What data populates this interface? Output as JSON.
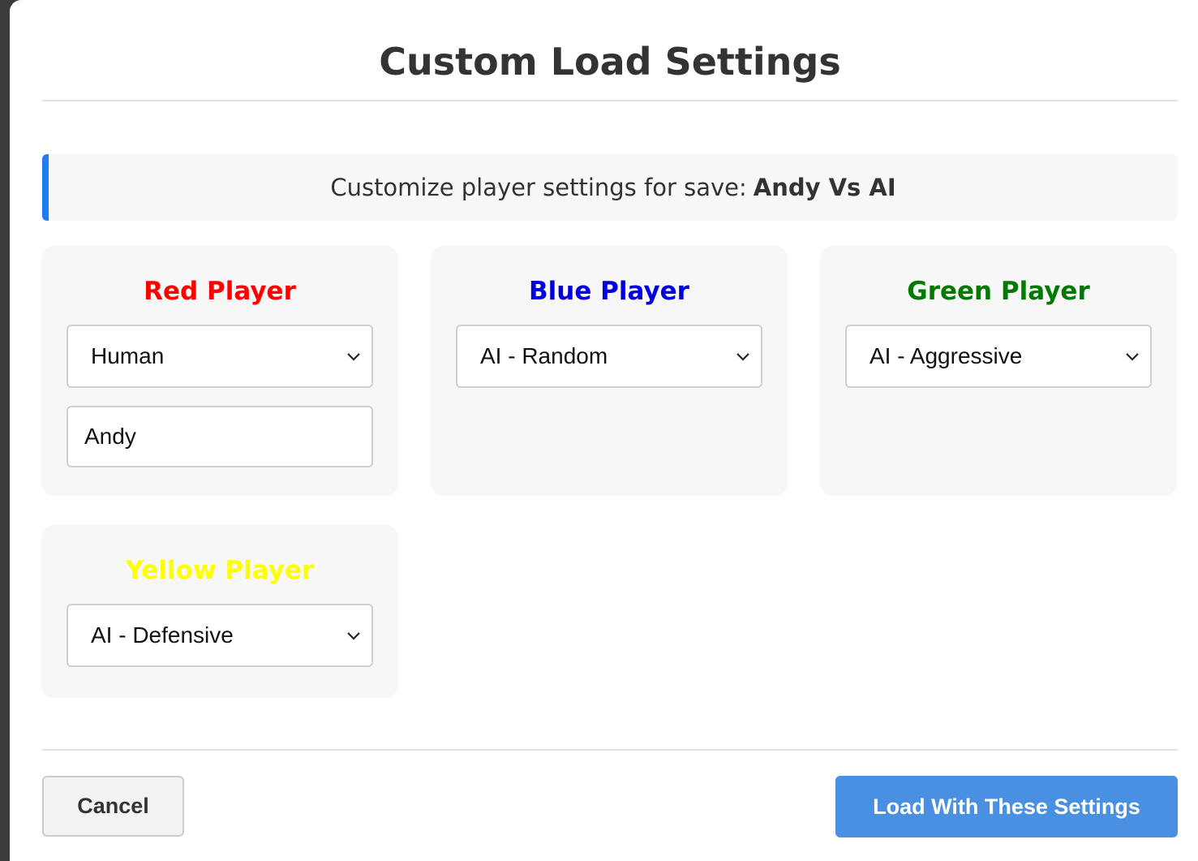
{
  "dialog": {
    "title": "Custom Load Settings",
    "info_prefix": "Customize player settings for save:",
    "save_name": "Andy Vs AI",
    "accent_color": "#1e7ef0"
  },
  "players": [
    {
      "title": "Red Player",
      "color": "#ff0000",
      "type": "Human",
      "name": "Andy"
    },
    {
      "title": "Blue Player",
      "color": "#0000dd",
      "type": "AI - Random"
    },
    {
      "title": "Green Player",
      "color": "#007a00",
      "type": "AI - Aggressive"
    },
    {
      "title": "Yellow Player",
      "color": "#ffff00",
      "type": "AI - Defensive"
    }
  ],
  "footer": {
    "cancel_label": "Cancel",
    "load_label": "Load With These Settings",
    "load_color": "#4a90e2"
  }
}
